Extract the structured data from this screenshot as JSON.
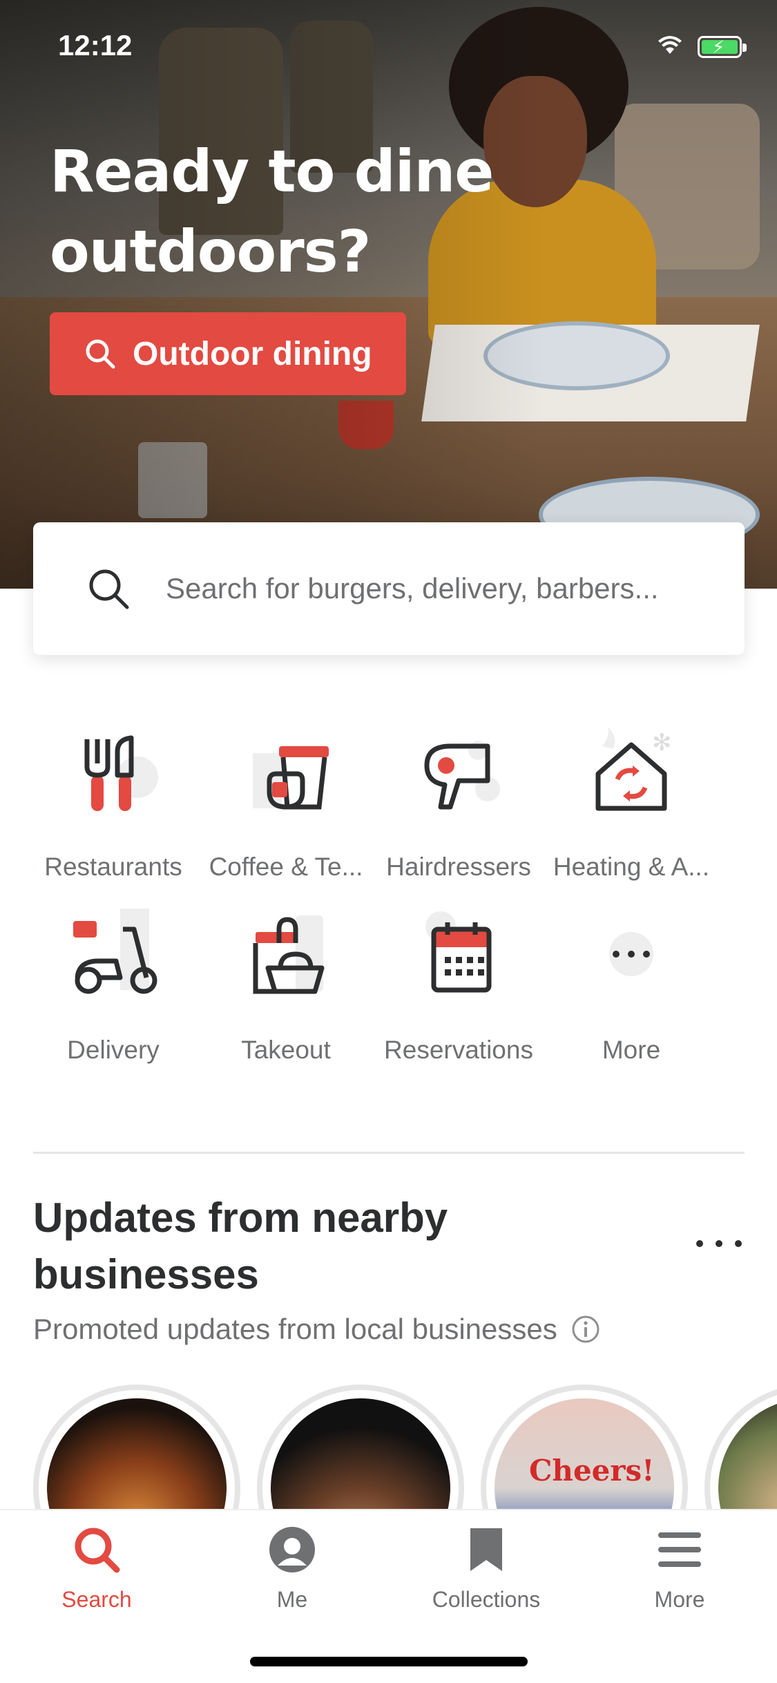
{
  "status_bar": {
    "time": "12:12"
  },
  "hero": {
    "title": "Ready to dine outdoors?",
    "cta_label": "Outdoor dining"
  },
  "search": {
    "placeholder": "Search for burgers, delivery, barbers..."
  },
  "categories": [
    {
      "label": "Restaurants",
      "icon": "fork-knife-icon"
    },
    {
      "label": "Coffee & Te...",
      "icon": "coffee-cup-icon"
    },
    {
      "label": "Hairdressers",
      "icon": "hair-dryer-icon"
    },
    {
      "label": "Heating & A...",
      "icon": "house-heating-icon"
    },
    {
      "label": "Delivery",
      "icon": "scooter-icon"
    },
    {
      "label": "Takeout",
      "icon": "takeout-basket-icon"
    },
    {
      "label": "Reservations",
      "icon": "calendar-icon"
    },
    {
      "label": "More",
      "icon": "more-dots-icon"
    }
  ],
  "updates": {
    "title": "Updates from nearby businesses",
    "subtitle": "Promoted updates from local businesses",
    "story_text": "Cheers!"
  },
  "tabbar": {
    "items": [
      {
        "label": "Search",
        "icon": "search-icon",
        "active": true
      },
      {
        "label": "Me",
        "icon": "profile-icon",
        "active": false
      },
      {
        "label": "Collections",
        "icon": "bookmark-icon",
        "active": false
      },
      {
        "label": "More",
        "icon": "menu-icon",
        "active": false
      }
    ]
  },
  "colors": {
    "accent": "#e34a41",
    "text_primary": "#2d2e2f",
    "text_secondary": "#6e7072"
  }
}
